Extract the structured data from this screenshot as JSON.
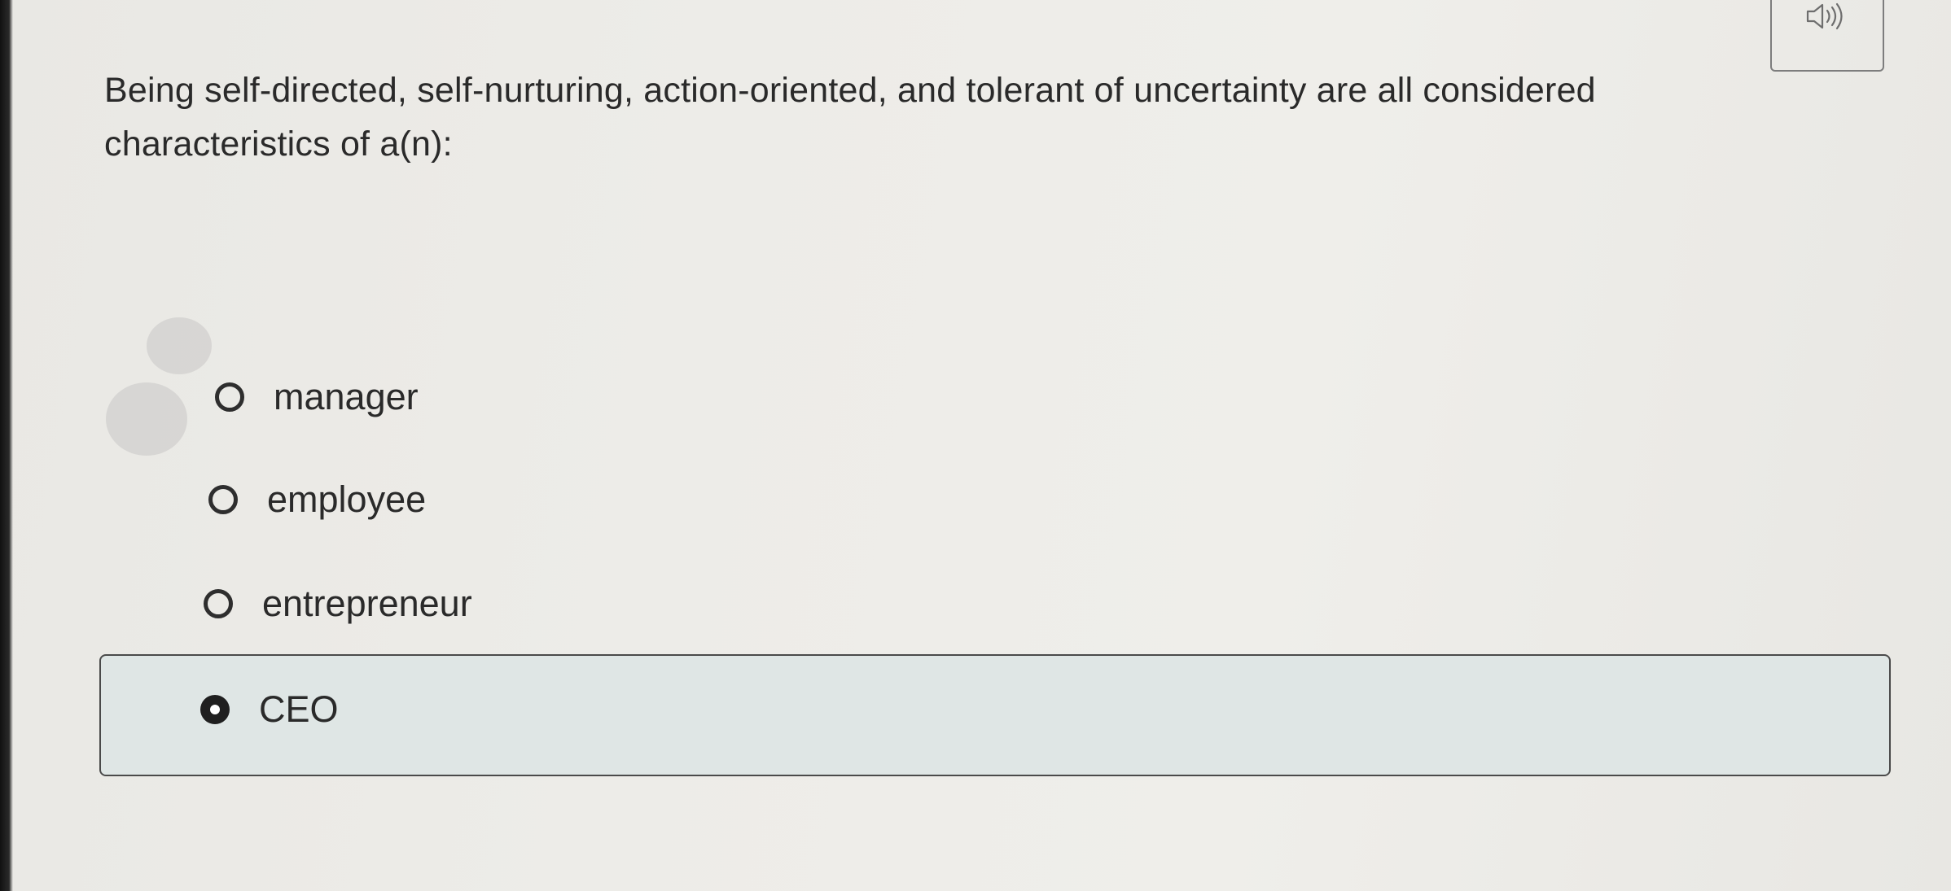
{
  "question": {
    "text": "Being self-directed, self-nurturing, action-oriented, and tolerant of uncertainty are all considered characteristics of a(n):"
  },
  "audio": {
    "icon": "speaker-icon"
  },
  "options": [
    {
      "label": "manager",
      "selected": false
    },
    {
      "label": "employee",
      "selected": false
    },
    {
      "label": "entrepreneur",
      "selected": false
    },
    {
      "label": "CEO",
      "selected": true
    }
  ],
  "colors": {
    "background": "#edece8",
    "selected_background": "#dfe6e5",
    "text": "#2a2a2a",
    "radio": "#2e2e2e"
  }
}
